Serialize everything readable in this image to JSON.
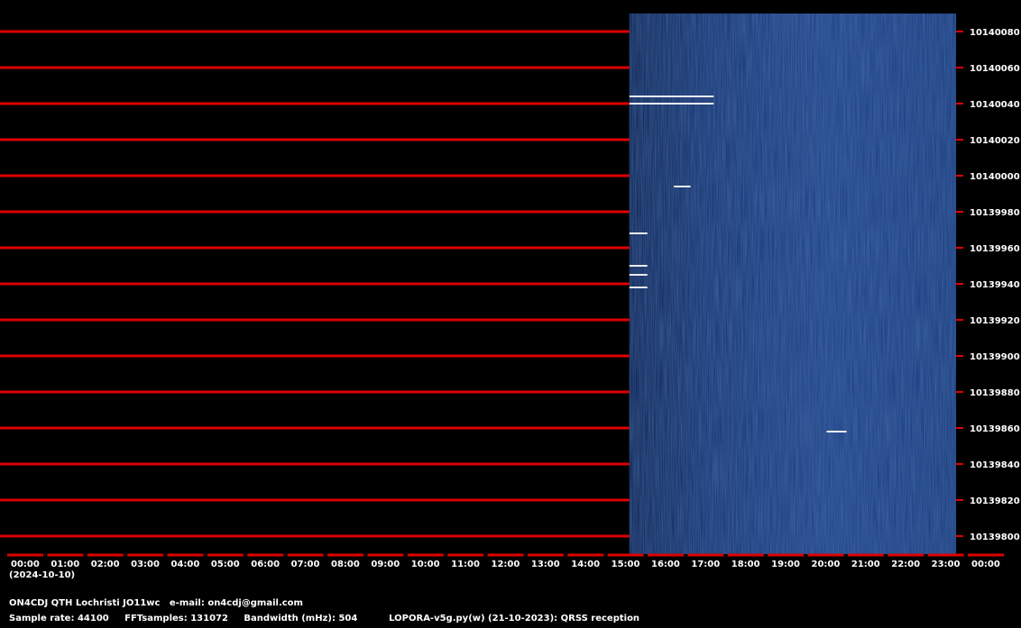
{
  "chart_data": {
    "type": "heatmap",
    "title": "",
    "date_label": "(2024-10-10)",
    "x_ticks": [
      "00:00",
      "01:00",
      "02:00",
      "03:00",
      "04:00",
      "05:00",
      "06:00",
      "07:00",
      "08:00",
      "09:00",
      "10:00",
      "11:00",
      "12:00",
      "13:00",
      "14:00",
      "15:00",
      "16:00",
      "17:00",
      "18:00",
      "19:00",
      "20:00",
      "21:00",
      "22:00",
      "23:00",
      "00:00"
    ],
    "y_ticks": [
      10140080,
      10140060,
      10140040,
      10140020,
      10140000,
      10139980,
      10139960,
      10139940,
      10139920,
      10139900,
      10139880,
      10139860,
      10139840,
      10139820,
      10139800
    ],
    "xlim": [
      "00:00",
      "24:00"
    ],
    "ylim": [
      10139790,
      10140090
    ],
    "reception_start": "15:48",
    "reception_end": "24:00",
    "signals": [
      {
        "start": "15:48",
        "end": "17:55",
        "freq": 10140044
      },
      {
        "start": "15:48",
        "end": "17:55",
        "freq": 10140040
      },
      {
        "start": "15:48",
        "end": "16:15",
        "freq": 10139968
      },
      {
        "start": "15:48",
        "end": "16:15",
        "freq": 10139950
      },
      {
        "start": "15:48",
        "end": "16:15",
        "freq": 10139945
      },
      {
        "start": "15:48",
        "end": "16:15",
        "freq": 10139938
      },
      {
        "start": "16:55",
        "end": "17:20",
        "freq": 10139994
      },
      {
        "start": "20:45",
        "end": "21:15",
        "freq": 10139858
      }
    ],
    "colors": {
      "background": "#000000",
      "grid": "#dd0000",
      "waterfall": "#0f2f72",
      "signal": "#ffffff"
    }
  },
  "footer": {
    "line1": "ON4CDJ QTH Lochristi JO11wc   e-mail: on4cdj@gmail.com",
    "line2": "Sample rate: 44100     FFTsamples: 131072     Bandwidth (mHz): 504          LOPORA-v5g.py(w) (21-10-2023): QRSS reception"
  }
}
